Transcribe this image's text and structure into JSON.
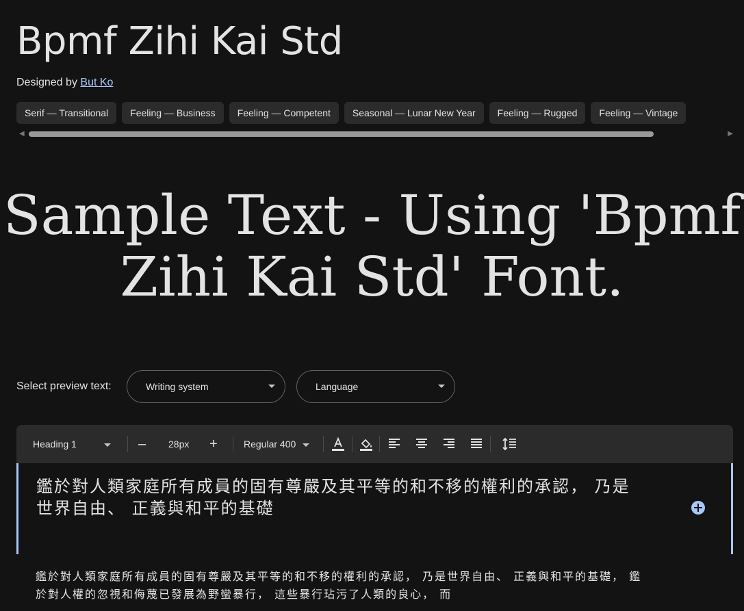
{
  "font": {
    "name": "Bpmf Zihi Kai Std",
    "designed_by_label": "Designed by",
    "designer": "But Ko"
  },
  "tags": [
    "Serif — Transitional",
    "Feeling — Business",
    "Feeling — Competent",
    "Seasonal — Lunar New Year",
    "Feeling — Rugged",
    "Feeling — Vintage"
  ],
  "sample_text": "Sample Text - Using 'Bpmf Zihi Kai Std' Font.",
  "preview": {
    "label": "Select preview text:",
    "writing_system": "Writing system",
    "language": "Language"
  },
  "toolbar": {
    "style": "Heading 1",
    "decrease": "–",
    "size": "28px",
    "increase": "+",
    "weight": "Regular 400"
  },
  "editor_text": "鑑於對人類家庭所有成員的固有尊嚴及其平等的和不移的權利的承認， 乃是世界自由、 正義與和平的基礎",
  "body_text": "鑑於對人類家庭所有成員的固有尊嚴及其平等的和不移的權利的承認， 乃是世界自由、 正義與和平的基礎， 鑑於對人權的忽視和侮蔑已發展為野蠻暴行， 這些暴行玷污了人類的良心， 而"
}
